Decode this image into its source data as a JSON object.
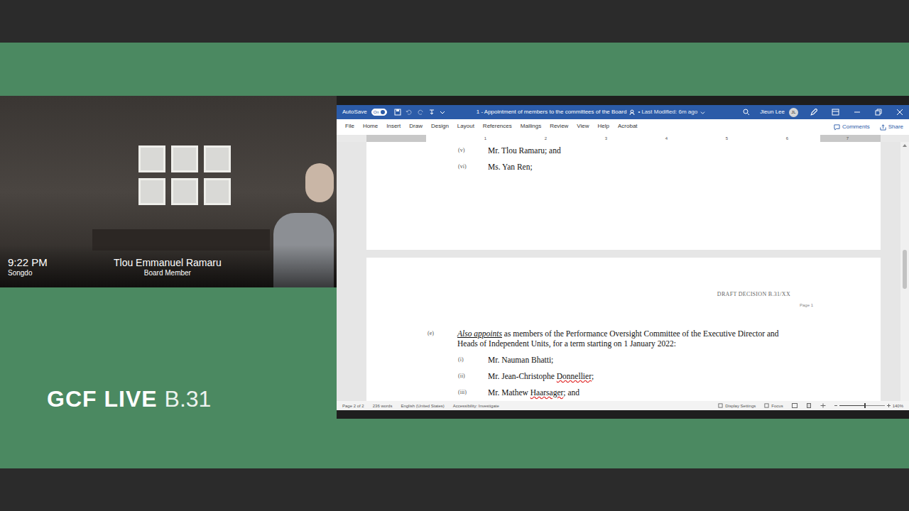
{
  "stream": {
    "brand": "GCF LIVE",
    "session": "B.31"
  },
  "video": {
    "time": "9:22 PM",
    "location": "Songdo",
    "speaker": "Tlou Emmanuel Ramaru",
    "role": "Board Member"
  },
  "word": {
    "autosave": {
      "label": "AutoSave",
      "state": "On",
      "on": true
    },
    "title": "1 - Appointment of members to the committees of the Board",
    "modified": "• Last Modified: 6m ago",
    "user": "Jieun Lee",
    "initials": "JL",
    "menu": [
      {
        "label": "File",
        "selected": false
      },
      {
        "label": "Home",
        "selected": false
      },
      {
        "label": "Insert",
        "selected": false
      },
      {
        "label": "Draw",
        "selected": false
      },
      {
        "label": "Design",
        "selected": false
      },
      {
        "label": "Layout",
        "selected": false
      },
      {
        "label": "References",
        "selected": false
      },
      {
        "label": "Mailings",
        "selected": false
      },
      {
        "label": "Review",
        "selected": false
      },
      {
        "label": "View",
        "selected": false
      },
      {
        "label": "Help",
        "selected": false
      },
      {
        "label": "Acrobat",
        "selected": false
      }
    ],
    "comments": "Comments",
    "share": "Share",
    "ruler": [
      "1",
      "2",
      "3",
      "4",
      "5",
      "6",
      "7"
    ],
    "document": {
      "page_tail": [
        {
          "num": "(v)",
          "parts": [
            {
              "text": "Mr. Tlou Ramaru; and",
              "misspelled": false
            }
          ]
        },
        {
          "num": "(vi)",
          "parts": [
            {
              "text": "Ms. Yan Ren;",
              "misspelled": false
            }
          ]
        }
      ],
      "header": "DRAFT DECISION B.31/XX",
      "page_label": "Page 1",
      "paragraph": {
        "num": "(e)",
        "lead": "Also appoints",
        "text": " as members of the Performance Oversight Committee of the Executive Director and Heads of Independent Units, for a term starting on 1 January 2022:"
      },
      "items": [
        {
          "num": "(i)",
          "parts": [
            {
              "text": "Mr. Nauman Bhatti;",
              "misspelled": false
            }
          ]
        },
        {
          "num": "(ii)",
          "parts": [
            {
              "text": "Mr. Jean-Christophe ",
              "misspelled": false
            },
            {
              "text": "Donnellier",
              "misspelled": true
            },
            {
              "text": ";",
              "misspelled": false
            }
          ]
        },
        {
          "num": "(iii)",
          "parts": [
            {
              "text": "Mr. Mathew ",
              "misspelled": false
            },
            {
              "text": "Haarsager",
              "misspelled": true
            },
            {
              "text": "; and",
              "misspelled": false
            }
          ]
        }
      ]
    },
    "status": {
      "left": [
        "Page 2 of 2",
        "236 words",
        "English (United States)",
        "Accessibility: Investigate"
      ],
      "right": [
        "Display Settings",
        "Focus"
      ],
      "zoom": "140%",
      "zoom_level": 0.55
    }
  }
}
